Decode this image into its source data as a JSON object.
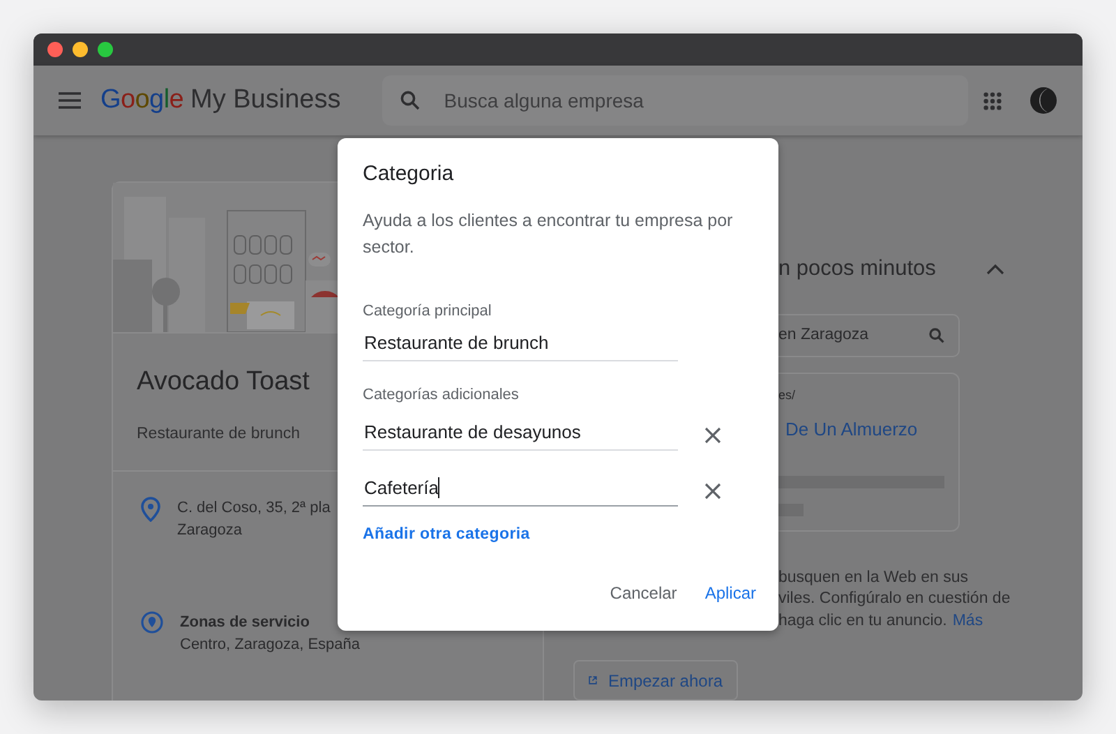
{
  "header": {
    "logo_brand": "Google",
    "logo_product": "My Business",
    "search": {
      "placeholder": "Busca alguna empresa"
    }
  },
  "business_card": {
    "name": "Avocado Toast",
    "category": "Restaurante de brunch",
    "address": [
      "C. del Coso, 35, 2ª pla",
      "Zaragoza"
    ],
    "service_area": {
      "title": "Zonas de servicio",
      "value": "Centro, Zaragoza, España"
    }
  },
  "promo_panel": {
    "heading": "n pocos minutos",
    "expanded": true,
    "search_value": "en Zaragoza",
    "preview": {
      "url": "es/",
      "title": "De Un Almuerzo"
    },
    "description_lines": [
      "busquen en la Web en sus",
      "viles. Configúralo en cuestión de",
      "haga clic en tu anuncio."
    ],
    "more_link": "Más",
    "button": "Empezar ahora"
  },
  "dialog": {
    "title": "Categoria",
    "description": "Ayuda a los clientes a encontrar tu empresa por sector.",
    "primary_label": "Categoría principal",
    "primary_value": "Restaurante de brunch",
    "additional_label": "Categorías adicionales",
    "additional": [
      {
        "value": "Restaurante de desayunos",
        "focused": false
      },
      {
        "value": "Cafetería",
        "focused": true
      }
    ],
    "add_link": "Añadir otra categoria",
    "buttons": [
      {
        "label": "Cancelar",
        "kind": "text"
      },
      {
        "label": "Aplicar",
        "kind": "primary"
      }
    ]
  }
}
